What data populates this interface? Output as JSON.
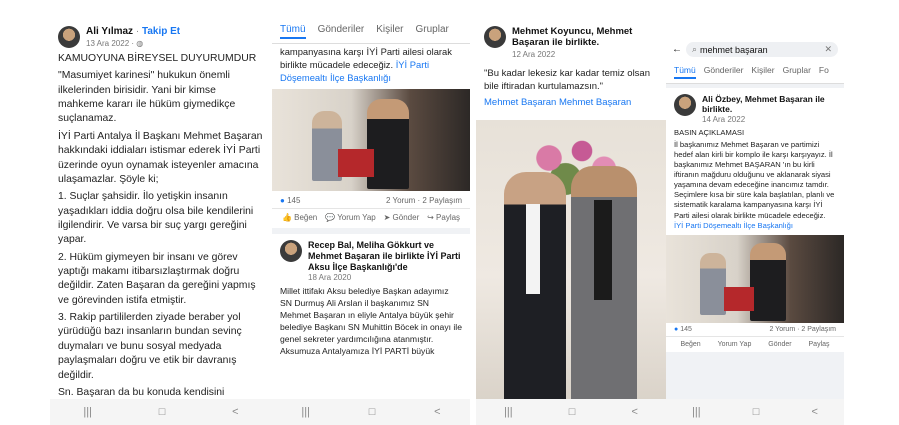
{
  "panel1": {
    "author": "Ali Yılmaz",
    "follow": "Takip Et",
    "date": "13 Ara 2022",
    "paragraphs": [
      "KAMUOYUNA BİREYSEL DUYURUMDUR",
      "\"Masumiyet karinesi\" hukukun önemli ilkelerinden birisidir. Yani bir kimse mahkeme kararı ile hüküm giymedikçe suçlanamaz.",
      "İYİ Parti Antalya İl Başkanı Mehmet Başaran hakkındaki iddiaları istismar ederek İYİ Parti üzerinde oyun oynamak isteyenler amacına ulaşamazlar. Şöyle ki;",
      "1. Suçlar şahsidir. İlo yetişkin insanın yaşadıkları iddia doğru olsa bile kendilerini ilgilendirir. Ve varsa bir suç yargı gereğini yapar.",
      "2. Hüküm giymeyen bir insanı ve görev yaptığı makamı itibarsızlaştırmak doğru değildir. Zaten Başaran da gereğini yapmış ve görevinden istifa etmiştir.",
      "3. Rakip partililerden ziyade beraber yol yürüdüğü bazı insanların bundan sevinç duymaları ve bunu sosyal medyada paylaşmaları doğru ve etik bir davranış değildir.",
      "Sn. Başaran da bu konuda kendisini"
    ]
  },
  "panel2": {
    "tabs": [
      "Tümü",
      "Gönderiler",
      "Kişiler",
      "Gruplar"
    ],
    "top_text": "kampanyasına karşı İYİ Parti ailesi olarak birlikte mücadele edeceğiz.",
    "top_link": "İYİ Parti Döşemealtı İlçe Başkanlığı",
    "reactions_count": "145",
    "comments_shares": "2 Yorum · 2 Paylaşım",
    "actions": [
      "Beğen",
      "Yorum Yap",
      "Gönder",
      "Paylaş"
    ],
    "post2_author": "Recep Bal, Meliha Gökkurt ve Mehmet Başaran ile birlikte İYİ Parti Aksu İlçe Başkanlığı'de",
    "post2_date": "18 Ara 2020",
    "post2_text": "Millet ittifakı Aksu belediye Başkan adayımız SN Durmuş Ali Arslan il başkanımız SN Mehmet Başaran ın eliyle Antalya büyük şehir belediye Başkanı SN Muhittin Böcek in onayı ile genel sekreter yardımcılığına atanmıştır. Aksumuza Antalyamıza İYİ PARTİ büyük"
  },
  "panel3": {
    "author": "Mehmet Koyuncu, Mehmet Başaran ile birlikte.",
    "date": "12 Ara 2022",
    "text": "\"Bu kadar lekesiz kar kadar temiz olsan bile iftiradan kurtulamazsın.\"",
    "tags": "Mehmet Başaran Mehmet Başaran"
  },
  "panel4": {
    "search": "mehmet başaran",
    "tabs": [
      "Tümü",
      "Gönderiler",
      "Kişiler",
      "Gruplar",
      "Fo"
    ],
    "author": "Ali Özbey, Mehmet Başaran ile birlikte.",
    "date": "14 Ara 2022",
    "heading": "BASIN AÇIKLAMASI",
    "text": "İl başkanımız Mehmet Başaran ve partimizi hedef alan kirli bir komplo ile karşı karşıyayız. İl başkanımız Mehmet BAŞARAN 'ın bu kirli iftiranın mağduru olduğunu ve aklanarak siyasi yaşamına devam edeceğine inancımız tamdır. Seçimlere kısa bir süre kala başlatılan, planlı ve sistematik karalama kampanyasına karşı İYİ Parti ailesi olarak birlikte mücadele edeceğiz.",
    "link": "İYİ Parti Döşemealtı İlçe Başkanlığı",
    "reactions_count": "145",
    "comments_shares": "2 Yorum · 2 Paylaşım",
    "actions": [
      "Beğen",
      "Yorum Yap",
      "Gönder",
      "Paylaş"
    ]
  },
  "navbar": [
    "|||",
    "□",
    "<"
  ]
}
